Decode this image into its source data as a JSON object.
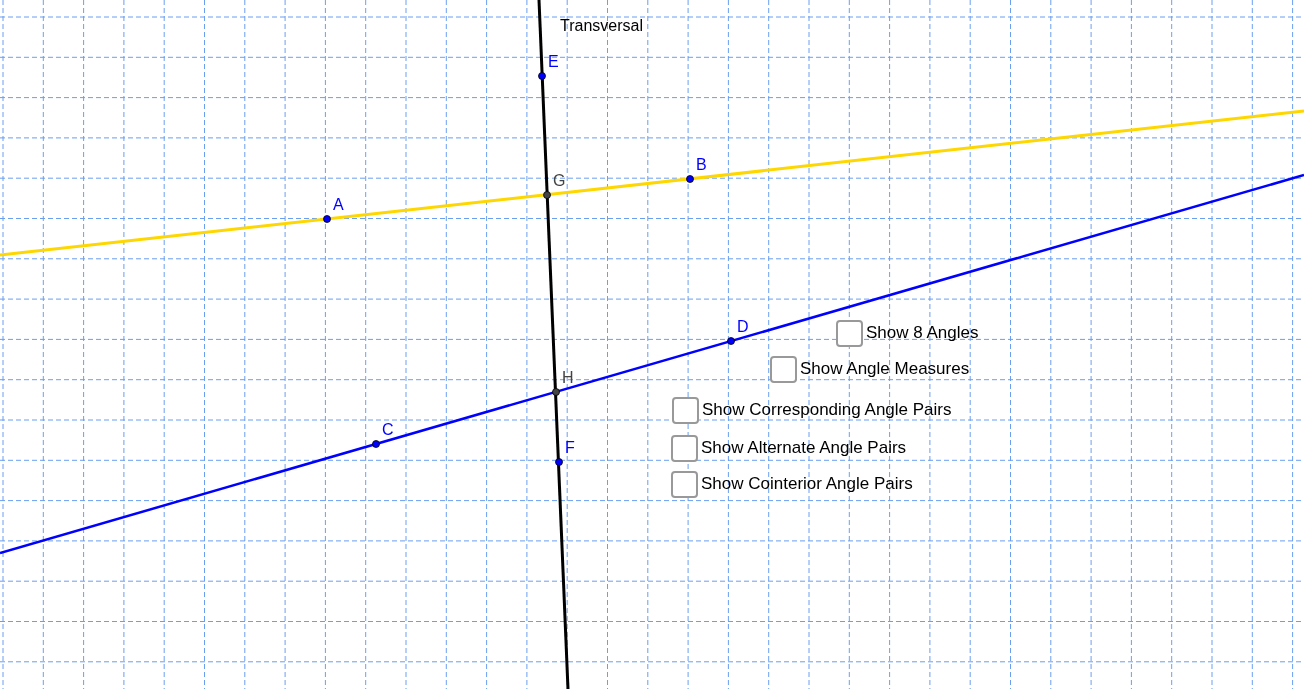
{
  "line_label": "Transversal",
  "points": [
    {
      "label": "E",
      "color": "#0000ff"
    },
    {
      "label": "G",
      "color": "#444444"
    },
    {
      "label": "B",
      "color": "#0000ff"
    },
    {
      "label": "A",
      "color": "#0000ff"
    },
    {
      "label": "D",
      "color": "#0000ff"
    },
    {
      "label": "H",
      "color": "#444444"
    },
    {
      "label": "C",
      "color": "#0000ff"
    },
    {
      "label": "F",
      "color": "#0000ff"
    }
  ],
  "checkboxes": [
    {
      "label": "Show 8 Angles",
      "checked": false
    },
    {
      "label": "Show Angle Measures",
      "checked": false
    },
    {
      "label": "Show Corresponding Angle Pairs",
      "checked": false
    },
    {
      "label": "Show Alternate Angle Pairs",
      "checked": false
    },
    {
      "label": "Show Cointerior Angle Pairs",
      "checked": false
    }
  ]
}
